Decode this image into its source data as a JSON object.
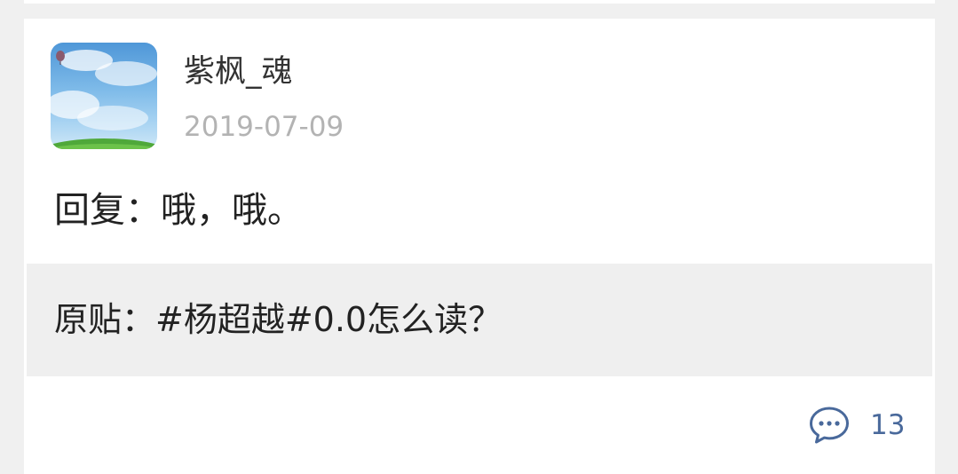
{
  "post": {
    "author": {
      "name": "紫枫_魂"
    },
    "date": "2019-07-09",
    "reply_text": "回复：哦，哦。",
    "original_text": "原贴：#杨超越#0.0怎么读？",
    "comment_count": "13",
    "icons": {
      "comment": "comment-bubble-icon",
      "avatar": "sky-clouds-balloon-avatar"
    },
    "colors": {
      "accent": "#49699b",
      "muted": "#b3b3b3",
      "quote_background": "#efefef"
    }
  }
}
